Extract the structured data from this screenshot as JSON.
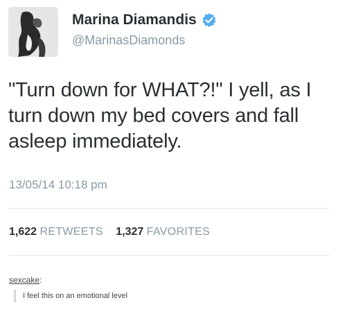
{
  "user": {
    "name": "Marina Diamandis",
    "handle": "@MarinasDiamonds",
    "verified": true,
    "verified_color": "#55acee"
  },
  "tweet": {
    "text": "\"Turn down for WHAT?!\" I yell, as I turn down my bed covers and fall asleep immediately.",
    "timestamp": "13/05/14 10:18 pm",
    "retweets_count": "1,622",
    "retweets_label": "RETWEETS",
    "favorites_count": "1,327",
    "favorites_label": "FAVORITES"
  },
  "reblog": {
    "username": "sexcake",
    "separator": ":",
    "comment": "I feel this on an emotional level"
  },
  "icons": {
    "verified": "verified-badge-icon",
    "avatar": "profile-photo"
  }
}
